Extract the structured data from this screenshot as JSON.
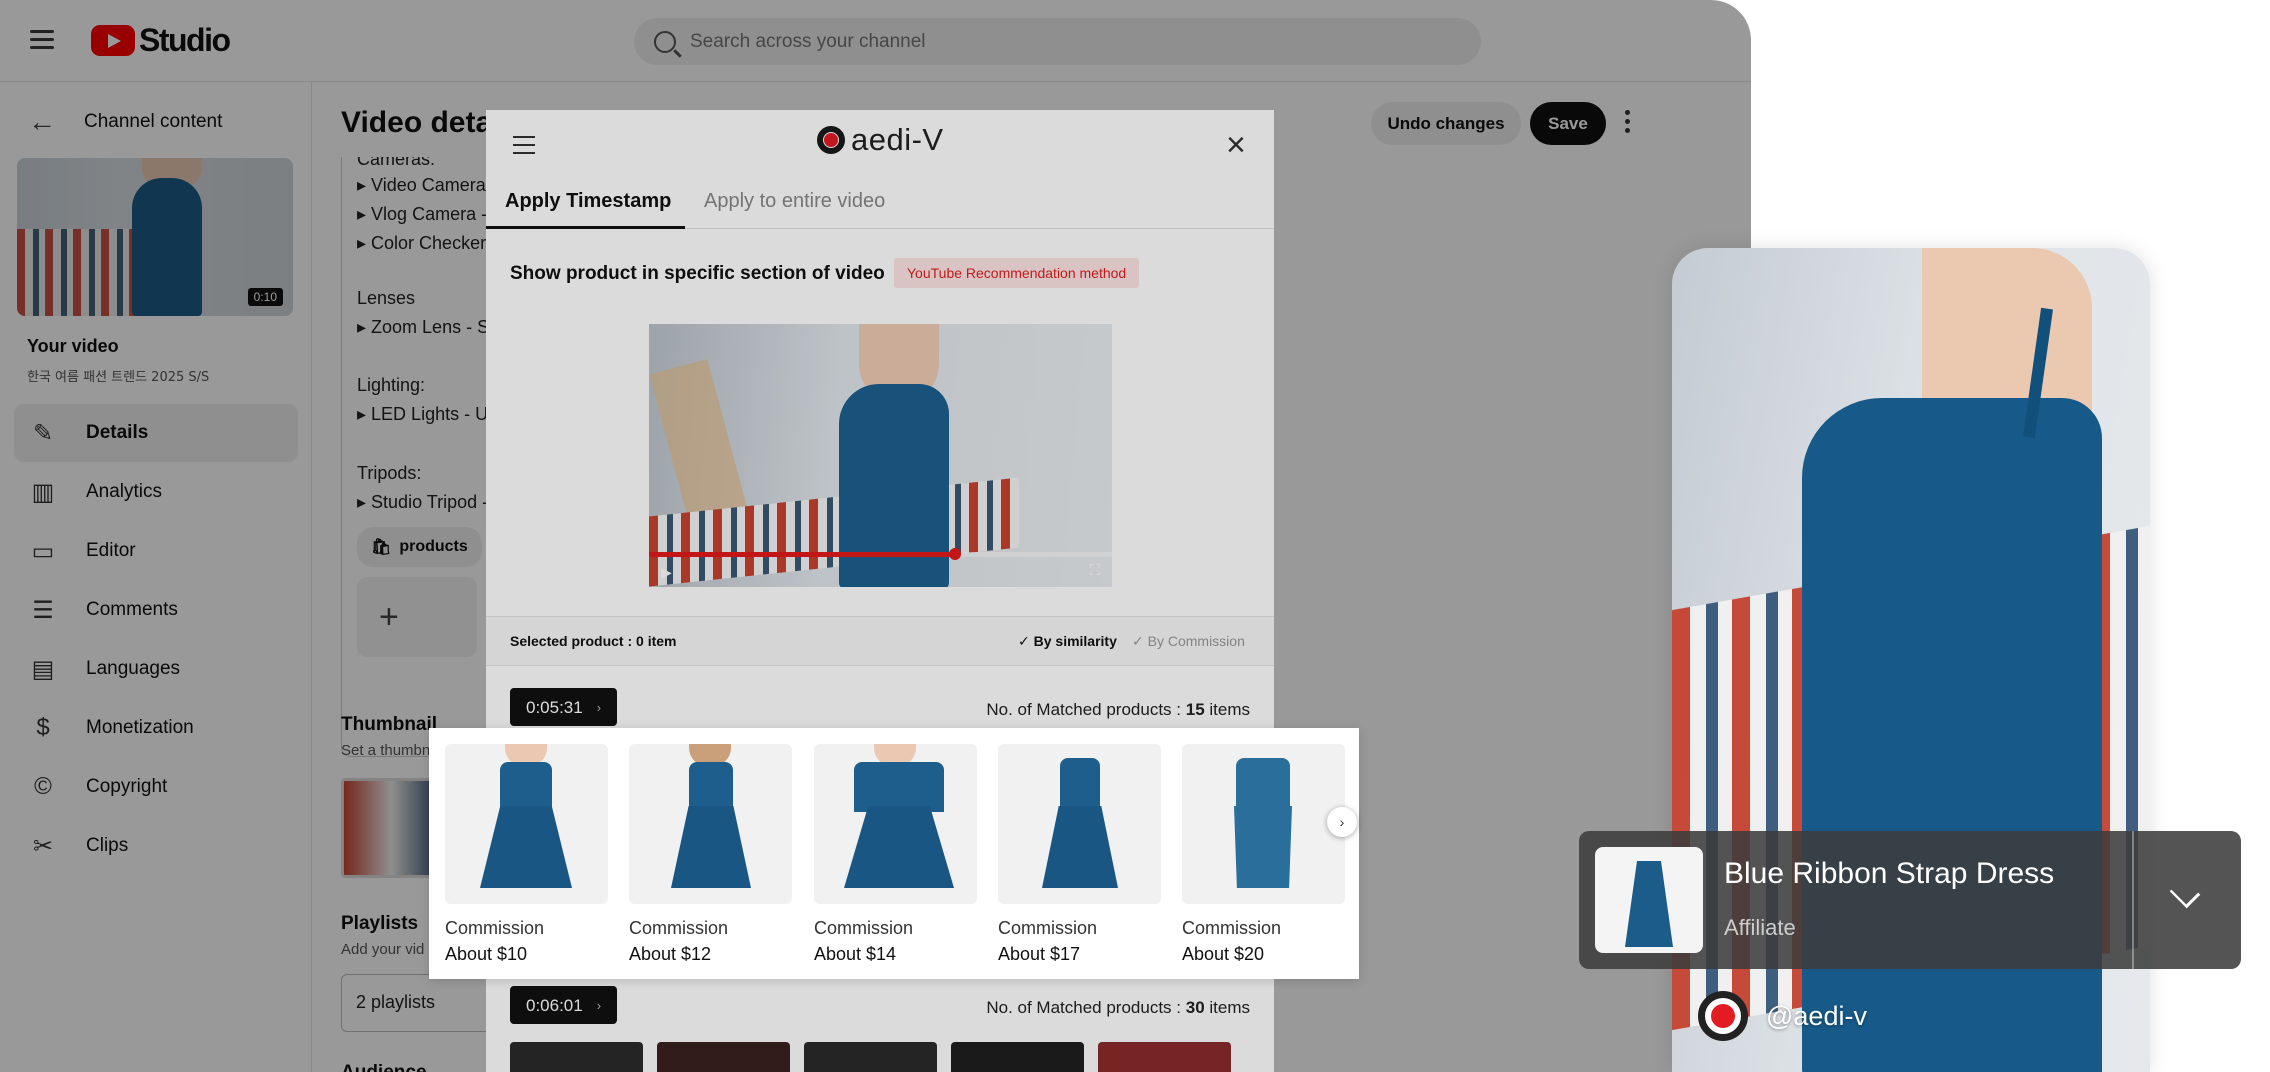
{
  "studio": {
    "logo_text": "Studio",
    "search_placeholder": "Search across your channel",
    "back_label": "Channel content",
    "thumb_duration": "0:10",
    "your_video": "Your video",
    "video_subtitle": "한국 여름 패션 트렌드 2025 S/S",
    "nav": [
      {
        "label": "Details",
        "icon": "pencil-icon",
        "active": true
      },
      {
        "label": "Analytics",
        "icon": "analytics-icon"
      },
      {
        "label": "Editor",
        "icon": "editor-icon"
      },
      {
        "label": "Comments",
        "icon": "comments-icon"
      },
      {
        "label": "Languages",
        "icon": "languages-icon"
      },
      {
        "label": "Monetization",
        "icon": "dollar-icon"
      },
      {
        "label": "Copyright",
        "icon": "copyright-icon"
      },
      {
        "label": "Clips",
        "icon": "scissors-icon"
      }
    ],
    "page_title": "Video details",
    "undo_label": "Undo changes",
    "save_label": "Save",
    "description_lines": [
      "Cameras:",
      "▸ Video Camera",
      "▸ Vlog Camera -",
      "▸ Color Checker",
      "Lenses",
      "▸ Zoom Lens - S",
      "Lighting:",
      "▸ LED Lights - UI",
      "Tripods:",
      "▸ Studio Tripod -"
    ],
    "products_chip": "products",
    "add_symbol": "+",
    "thumbnail_heading": "Thumbnail",
    "thumbnail_sub": "Set a thumbn",
    "playlists_heading": "Playlists",
    "playlists_sub": "Add your vid",
    "playlists_value": "2 playlists",
    "audience_heading": "Audience"
  },
  "modal": {
    "logo_text": "aedi-V",
    "tabs": [
      "Apply Timestamp",
      "Apply to entire video"
    ],
    "section_title": "Show product in specific section of video",
    "badge": "YouTube Recommendation method",
    "video_progress": 0.66,
    "selected_label": "Selected product : 0 item",
    "sort_similarity": "✓ By similarity",
    "sort_commission": "✓ By Commission",
    "groups": [
      {
        "timestamp": "0:05:31",
        "matched_prefix": "No. of Matched products : ",
        "matched_count": "15",
        "matched_suffix": " items"
      },
      {
        "timestamp": "0:06:01",
        "matched_prefix": "No. of Matched products : ",
        "matched_count": "30",
        "matched_suffix": " items"
      }
    ],
    "products": [
      {
        "label": "Commission",
        "price": "About $10"
      },
      {
        "label": "Commission",
        "price": "About $12"
      },
      {
        "label": "Commission",
        "price": "About $14"
      },
      {
        "label": "Commission",
        "price": "About $17"
      },
      {
        "label": "Commission",
        "price": "About $20"
      }
    ]
  },
  "preview": {
    "product_name": "Blue Ribbon Strap Dress",
    "product_sub": "Affiliate",
    "handle": "@aedi-v"
  },
  "colors": {
    "accent_red": "#e31b23",
    "dress_blue": "#1a5683",
    "badge_bg": "#fde3e3"
  }
}
